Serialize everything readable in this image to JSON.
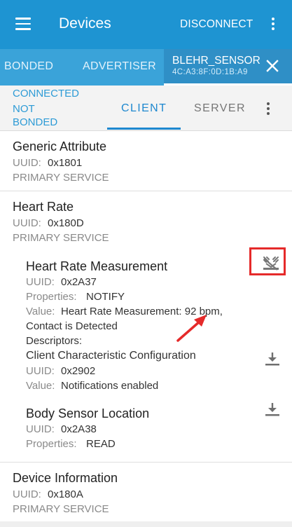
{
  "appbar": {
    "title": "Devices",
    "disconnect_label": "DISCONNECT"
  },
  "tabs": {
    "bonded": "BONDED",
    "advertiser": "ADVERTISER",
    "device_name": "BLEHR_SENSOR",
    "device_address": "4C:A3:8F:0D:1B:A9"
  },
  "subbar": {
    "status_connected": "CONNECTED",
    "status_not": "NOT",
    "status_bonded": "BONDED",
    "client_tab": "CLIENT",
    "server_tab": "SERVER"
  },
  "services": [
    {
      "name": "Generic Attribute",
      "uuid_label": "UUID:",
      "uuid": "0x1801",
      "type": "PRIMARY SERVICE"
    },
    {
      "name": "Heart Rate",
      "uuid_label": "UUID:",
      "uuid": "0x180D",
      "type": "PRIMARY SERVICE"
    },
    {
      "name": "Device Information",
      "uuid_label": "UUID:",
      "uuid": "0x180A",
      "type": "PRIMARY SERVICE"
    }
  ],
  "characteristics": [
    {
      "name": "Heart Rate Measurement",
      "uuid_label": "UUID:",
      "uuid": "0x2A37",
      "properties_label": "Properties:",
      "properties": "NOTIFY",
      "value_label": "Value:",
      "value_line1": "Heart Rate Measurement: 92 bpm,",
      "value_line2": "Contact is Detected",
      "descriptors_label": "Descriptors:",
      "descriptor": {
        "name": "Client Characteristic Configuration",
        "uuid_label": "UUID:",
        "uuid": "0x2902",
        "value_label": "Value:",
        "value": "Notifications enabled"
      }
    },
    {
      "name": "Body Sensor Location",
      "uuid_label": "UUID:",
      "uuid": "0x2A38",
      "properties_label": "Properties:",
      "properties": "READ"
    }
  ],
  "colors": {
    "appbar": "#1e94d2",
    "tabbar": "#3aa3d9",
    "accent": "#1e88cf",
    "highlight": "#e52a2a"
  },
  "icons": [
    "menu-icon",
    "more-vert-icon",
    "close-icon",
    "notify-disabled-icon",
    "download-icon",
    "annotation-arrow"
  ]
}
